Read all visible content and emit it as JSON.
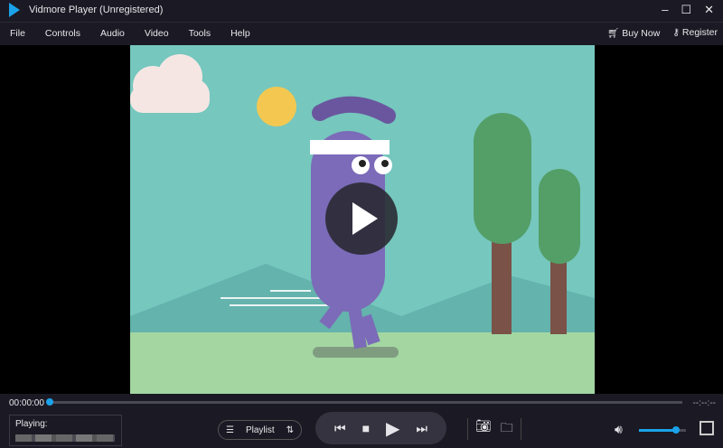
{
  "window": {
    "title": "Vidmore Player (Unregistered)",
    "controls": [
      "minimize",
      "maximize",
      "close"
    ]
  },
  "menu": {
    "items": [
      "File",
      "Controls",
      "Audio",
      "Video",
      "Tools",
      "Help"
    ],
    "buy_now": "Buy Now",
    "register": "Register"
  },
  "player": {
    "current_time": "00:00:00",
    "total_time": "--:--:--",
    "progress": 0,
    "playing_label": "Playing:",
    "playlist_label": "Playlist",
    "volume": 0.75
  },
  "colors": {
    "accent": "#1aa3ea",
    "background": "#1b1a24"
  }
}
